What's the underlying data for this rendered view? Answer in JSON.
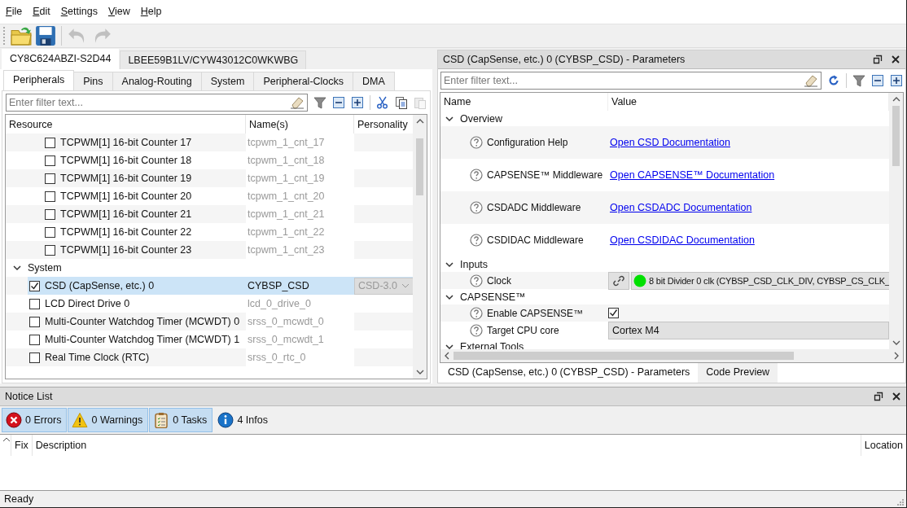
{
  "menu": [
    "File",
    "Edit",
    "Settings",
    "View",
    "Help"
  ],
  "toolbar": [
    {
      "kind": "open",
      "disabled": false
    },
    {
      "kind": "save",
      "disabled": false
    },
    {
      "kind": "undo",
      "disabled": true
    },
    {
      "kind": "redo",
      "disabled": true
    }
  ],
  "device_tabs": [
    {
      "label": "CY8C624ABZI-S2D44",
      "selected": true
    },
    {
      "label": "LBEE59B1LV/CYW43012C0WKWBG",
      "selected": false
    }
  ],
  "view_tabs": [
    {
      "label": "Peripherals",
      "selected": true
    },
    {
      "label": "Pins",
      "selected": false
    },
    {
      "label": "Analog-Routing",
      "selected": false
    },
    {
      "label": "System",
      "selected": false
    },
    {
      "label": "Peripheral-Clocks",
      "selected": false
    },
    {
      "label": "DMA",
      "selected": false
    }
  ],
  "resource_filter": {
    "placeholder": "Enter filter text..."
  },
  "resource_tools": [
    {
      "kind": "filter",
      "disabled": false
    },
    {
      "kind": "collapse",
      "disabled": false
    },
    {
      "kind": "expand",
      "disabled": false
    },
    {
      "kind": "cut",
      "disabled": false
    },
    {
      "kind": "copy",
      "disabled": false
    },
    {
      "kind": "paste",
      "disabled": true
    }
  ],
  "resource_table": {
    "columns": [
      "Resource",
      "Name(s)",
      "Personality"
    ],
    "items": [
      {
        "children": [
          {
            "children": [
              {
                "label": "TCPWM[1] 16-bit Counter 17",
                "name": "tcpwm_1_cnt_17",
                "checked": false,
                "selected": false
              },
              {
                "label": "TCPWM[1] 16-bit Counter 18",
                "name": "tcpwm_1_cnt_18",
                "checked": false,
                "selected": false
              },
              {
                "label": "TCPWM[1] 16-bit Counter 19",
                "name": "tcpwm_1_cnt_19",
                "checked": false,
                "selected": false
              },
              {
                "label": "TCPWM[1] 16-bit Counter 20",
                "name": "tcpwm_1_cnt_20",
                "checked": false,
                "selected": false
              },
              {
                "label": "TCPWM[1] 16-bit Counter 21",
                "name": "tcpwm_1_cnt_21",
                "checked": false,
                "selected": false
              },
              {
                "label": "TCPWM[1] 16-bit Counter 22",
                "name": "tcpwm_1_cnt_22",
                "checked": false,
                "selected": false
              },
              {
                "label": "TCPWM[1] 16-bit Counter 23",
                "name": "tcpwm_1_cnt_23",
                "checked": false,
                "selected": false
              }
            ]
          }
        ]
      },
      {
        "label": "System",
        "expanded": true,
        "children": [
          {
            "label": "CSD (CapSense, etc.) 0",
            "name": "CYBSP_CSD",
            "personality": "CSD-3.0",
            "checked": true,
            "selected": true
          },
          {
            "label": "LCD Direct Drive 0",
            "name": "lcd_0_drive_0",
            "checked": false,
            "selected": false
          },
          {
            "label": "Multi-Counter Watchdog Timer (MCWDT) 0",
            "name": "srss_0_mcwdt_0",
            "checked": false,
            "selected": false
          },
          {
            "label": "Multi-Counter Watchdog Timer (MCWDT) 1",
            "name": "srss_0_mcwdt_1",
            "checked": false,
            "selected": false
          },
          {
            "label": "Real Time Clock (RTC)",
            "name": "srss_0_rtc_0",
            "checked": false,
            "selected": false
          }
        ]
      }
    ]
  },
  "parameters": {
    "title": "CSD (CapSense, etc.) 0 (CYBSP_CSD) - Parameters",
    "filter": {
      "placeholder": "Enter filter text..."
    },
    "tools": [
      {
        "kind": "refresh",
        "disabled": false
      },
      {
        "kind": "filter",
        "disabled": false
      },
      {
        "kind": "collapse",
        "disabled": false
      },
      {
        "kind": "expand",
        "disabled": false
      }
    ],
    "columns": [
      "Name",
      "Value"
    ],
    "sections": [
      {
        "label": "Overview",
        "expanded": true,
        "rows": [
          {
            "label": "Configuration Help",
            "kind": "link",
            "value": "Open CSD Documentation"
          },
          {
            "label": "CAPSENSE™ Middleware",
            "kind": "link",
            "value": "Open CAPSENSE™ Documentation"
          },
          {
            "label": "CSDADC Middleware",
            "kind": "link",
            "value": "Open CSDADC Documentation"
          },
          {
            "label": "CSDIDAC Middleware",
            "kind": "link",
            "value": "Open CSDIDAC Documentation"
          }
        ]
      },
      {
        "label": "Inputs",
        "expanded": true,
        "rows": [
          {
            "label": "Clock",
            "kind": "clock",
            "value": "8 bit Divider 0 clk (CYBSP_CSD_CLK_DIV, CYBSP_CS_CLK_"
          }
        ]
      },
      {
        "label": "CAPSENSE™",
        "expanded": true,
        "rows": [
          {
            "label": "Enable CAPSENSE™",
            "kind": "checkbox",
            "checked": true
          },
          {
            "label": "Target CPU core",
            "kind": "combo",
            "value": "Cortex M4"
          }
        ]
      },
      {
        "label": "External Tools",
        "expanded": true
      }
    ]
  },
  "bottom_tabs": [
    {
      "label": "CSD (CapSense, etc.) 0 (CYBSP_CSD) - Parameters",
      "selected": true
    },
    {
      "label": "Code Preview",
      "selected": false
    }
  ],
  "notice_list": {
    "title": "Notice List",
    "filters": [
      {
        "kind": "error",
        "label": "0 Errors",
        "selected": true
      },
      {
        "kind": "warning",
        "label": "0 Warnings",
        "selected": true
      },
      {
        "kind": "task",
        "label": "0 Tasks",
        "selected": true
      },
      {
        "kind": "info",
        "label": "4 Infos",
        "selected": false
      }
    ],
    "columns": [
      "Fix",
      "Description",
      "Location"
    ]
  },
  "status_bar": "Ready"
}
